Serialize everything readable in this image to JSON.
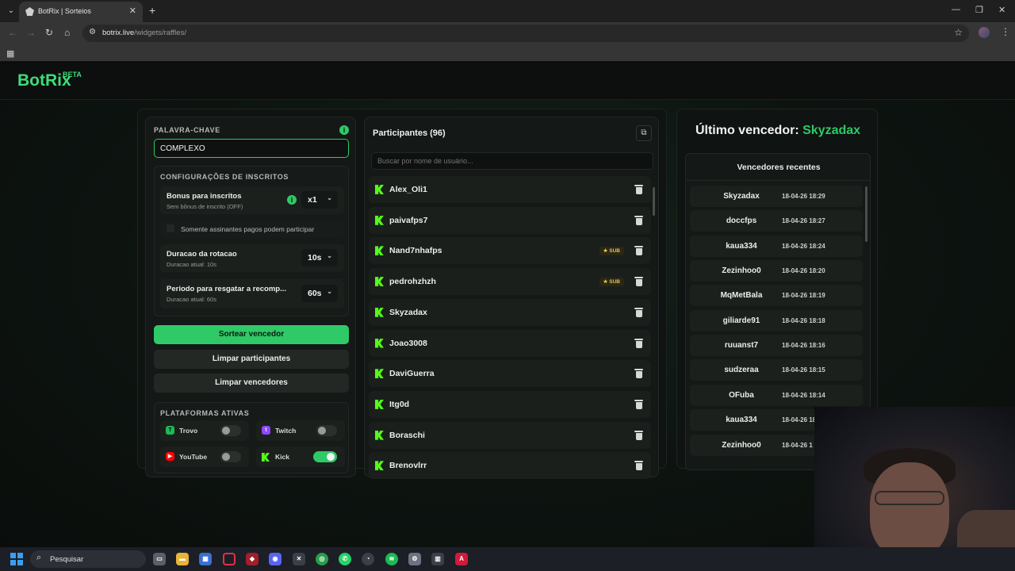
{
  "browser": {
    "tab_title": "BotRix | Sorteios",
    "url_host": "botrix.live",
    "url_path": "/widgets/raffles/"
  },
  "site": {
    "logo": "BotRix",
    "logo_badge": "BETA"
  },
  "left": {
    "keyword_label": "PALAVRA-CHAVE",
    "keyword_value": "COMPLEXO",
    "config_title": "CONFIGURAÇÕES DE INSCRITOS",
    "bonus_title": "Bonus para inscritos",
    "bonus_sub": "Sem bônus de inscrito (OFF)",
    "bonus_value": "x1",
    "paid_only_label": "Somente assinantes pagos podem participar",
    "rotation_title": "Duracao da rotacao",
    "rotation_sub": "Duracao atual: 10s",
    "rotation_value": "10s",
    "claim_title": "Periodo para resgatar a recomp...",
    "claim_sub": "Duracao atual: 60s",
    "claim_value": "60s",
    "draw_button": "Sortear vencedor",
    "clear_participants_button": "Limpar participantes",
    "clear_winners_button": "Limpar vencedores",
    "platforms_title": "PLATAFORMAS ATIVAS",
    "platforms": [
      {
        "name": "Trovo",
        "enabled": false,
        "color": "#1db954"
      },
      {
        "name": "Twitch",
        "enabled": false,
        "color": "#9146ff"
      },
      {
        "name": "YouTube",
        "enabled": false,
        "color": "#ff0000"
      },
      {
        "name": "Kick",
        "enabled": true,
        "color": "#53fc18"
      }
    ]
  },
  "middle": {
    "title": "Participantes (96)",
    "search_placeholder": "Buscar por nome de usuário...",
    "participants": [
      {
        "name": "Alex_Oli1",
        "sub": false
      },
      {
        "name": "paivafps7",
        "sub": false
      },
      {
        "name": "Nand7nhafps",
        "sub": true
      },
      {
        "name": "pedrohzhzh",
        "sub": true
      },
      {
        "name": "Skyzadax",
        "sub": false
      },
      {
        "name": "Joao3008",
        "sub": false
      },
      {
        "name": "DaviGuerra",
        "sub": false
      },
      {
        "name": "Itg0d",
        "sub": false
      },
      {
        "name": "Boraschi",
        "sub": false
      },
      {
        "name": "Brenovlrr",
        "sub": false
      }
    ],
    "sub_label": "★ SUB"
  },
  "right": {
    "last_winner_label": "Último vencedor:",
    "last_winner_name": "Skyzadax",
    "recent_title": "Vencedores recentes",
    "winners": [
      {
        "name": "Skyzadax",
        "time": "18-04-26 18:29"
      },
      {
        "name": "doccfps",
        "time": "18-04-26 18:27"
      },
      {
        "name": "kaua334",
        "time": "18-04-26 18:24"
      },
      {
        "name": "Zezinhoo0",
        "time": "18-04-26 18:20"
      },
      {
        "name": "MqMetBala",
        "time": "18-04-26 18:19"
      },
      {
        "name": "giliarde91",
        "time": "18-04-26 18:18"
      },
      {
        "name": "ruuanst7",
        "time": "18-04-26 18:16"
      },
      {
        "name": "sudzeraa",
        "time": "18-04-26 18:15"
      },
      {
        "name": "OFuba",
        "time": "18-04-26 18:14"
      },
      {
        "name": "kaua334",
        "time": "18-04-26 18"
      },
      {
        "name": "Zezinhoo0",
        "time": "18-04-26 1"
      }
    ]
  },
  "taskbar": {
    "search_label": "Pesquisar"
  },
  "colors": {
    "accent": "#2fc967",
    "kick": "#53fc18",
    "sub_badge": "#e6c34a"
  }
}
